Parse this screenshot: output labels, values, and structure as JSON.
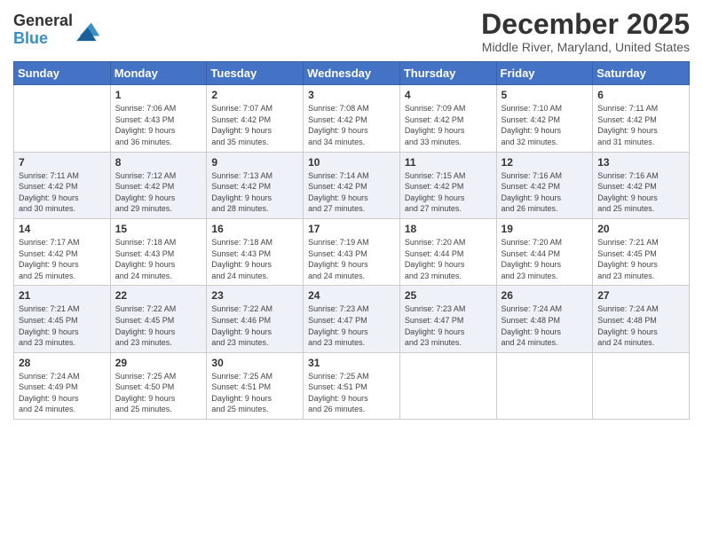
{
  "logo": {
    "line1": "General",
    "line2": "Blue"
  },
  "title": "December 2025",
  "subtitle": "Middle River, Maryland, United States",
  "days_header": [
    "Sunday",
    "Monday",
    "Tuesday",
    "Wednesday",
    "Thursday",
    "Friday",
    "Saturday"
  ],
  "weeks": [
    [
      {
        "day": "",
        "info": ""
      },
      {
        "day": "1",
        "info": "Sunrise: 7:06 AM\nSunset: 4:43 PM\nDaylight: 9 hours\nand 36 minutes."
      },
      {
        "day": "2",
        "info": "Sunrise: 7:07 AM\nSunset: 4:42 PM\nDaylight: 9 hours\nand 35 minutes."
      },
      {
        "day": "3",
        "info": "Sunrise: 7:08 AM\nSunset: 4:42 PM\nDaylight: 9 hours\nand 34 minutes."
      },
      {
        "day": "4",
        "info": "Sunrise: 7:09 AM\nSunset: 4:42 PM\nDaylight: 9 hours\nand 33 minutes."
      },
      {
        "day": "5",
        "info": "Sunrise: 7:10 AM\nSunset: 4:42 PM\nDaylight: 9 hours\nand 32 minutes."
      },
      {
        "day": "6",
        "info": "Sunrise: 7:11 AM\nSunset: 4:42 PM\nDaylight: 9 hours\nand 31 minutes."
      }
    ],
    [
      {
        "day": "7",
        "info": "Sunrise: 7:11 AM\nSunset: 4:42 PM\nDaylight: 9 hours\nand 30 minutes."
      },
      {
        "day": "8",
        "info": "Sunrise: 7:12 AM\nSunset: 4:42 PM\nDaylight: 9 hours\nand 29 minutes."
      },
      {
        "day": "9",
        "info": "Sunrise: 7:13 AM\nSunset: 4:42 PM\nDaylight: 9 hours\nand 28 minutes."
      },
      {
        "day": "10",
        "info": "Sunrise: 7:14 AM\nSunset: 4:42 PM\nDaylight: 9 hours\nand 27 minutes."
      },
      {
        "day": "11",
        "info": "Sunrise: 7:15 AM\nSunset: 4:42 PM\nDaylight: 9 hours\nand 27 minutes."
      },
      {
        "day": "12",
        "info": "Sunrise: 7:16 AM\nSunset: 4:42 PM\nDaylight: 9 hours\nand 26 minutes."
      },
      {
        "day": "13",
        "info": "Sunrise: 7:16 AM\nSunset: 4:42 PM\nDaylight: 9 hours\nand 25 minutes."
      }
    ],
    [
      {
        "day": "14",
        "info": "Sunrise: 7:17 AM\nSunset: 4:42 PM\nDaylight: 9 hours\nand 25 minutes."
      },
      {
        "day": "15",
        "info": "Sunrise: 7:18 AM\nSunset: 4:43 PM\nDaylight: 9 hours\nand 24 minutes."
      },
      {
        "day": "16",
        "info": "Sunrise: 7:18 AM\nSunset: 4:43 PM\nDaylight: 9 hours\nand 24 minutes."
      },
      {
        "day": "17",
        "info": "Sunrise: 7:19 AM\nSunset: 4:43 PM\nDaylight: 9 hours\nand 24 minutes."
      },
      {
        "day": "18",
        "info": "Sunrise: 7:20 AM\nSunset: 4:44 PM\nDaylight: 9 hours\nand 23 minutes."
      },
      {
        "day": "19",
        "info": "Sunrise: 7:20 AM\nSunset: 4:44 PM\nDaylight: 9 hours\nand 23 minutes."
      },
      {
        "day": "20",
        "info": "Sunrise: 7:21 AM\nSunset: 4:45 PM\nDaylight: 9 hours\nand 23 minutes."
      }
    ],
    [
      {
        "day": "21",
        "info": "Sunrise: 7:21 AM\nSunset: 4:45 PM\nDaylight: 9 hours\nand 23 minutes."
      },
      {
        "day": "22",
        "info": "Sunrise: 7:22 AM\nSunset: 4:45 PM\nDaylight: 9 hours\nand 23 minutes."
      },
      {
        "day": "23",
        "info": "Sunrise: 7:22 AM\nSunset: 4:46 PM\nDaylight: 9 hours\nand 23 minutes."
      },
      {
        "day": "24",
        "info": "Sunrise: 7:23 AM\nSunset: 4:47 PM\nDaylight: 9 hours\nand 23 minutes."
      },
      {
        "day": "25",
        "info": "Sunrise: 7:23 AM\nSunset: 4:47 PM\nDaylight: 9 hours\nand 23 minutes."
      },
      {
        "day": "26",
        "info": "Sunrise: 7:24 AM\nSunset: 4:48 PM\nDaylight: 9 hours\nand 24 minutes."
      },
      {
        "day": "27",
        "info": "Sunrise: 7:24 AM\nSunset: 4:48 PM\nDaylight: 9 hours\nand 24 minutes."
      }
    ],
    [
      {
        "day": "28",
        "info": "Sunrise: 7:24 AM\nSunset: 4:49 PM\nDaylight: 9 hours\nand 24 minutes."
      },
      {
        "day": "29",
        "info": "Sunrise: 7:25 AM\nSunset: 4:50 PM\nDaylight: 9 hours\nand 25 minutes."
      },
      {
        "day": "30",
        "info": "Sunrise: 7:25 AM\nSunset: 4:51 PM\nDaylight: 9 hours\nand 25 minutes."
      },
      {
        "day": "31",
        "info": "Sunrise: 7:25 AM\nSunset: 4:51 PM\nDaylight: 9 hours\nand 26 minutes."
      },
      {
        "day": "",
        "info": ""
      },
      {
        "day": "",
        "info": ""
      },
      {
        "day": "",
        "info": ""
      }
    ]
  ]
}
